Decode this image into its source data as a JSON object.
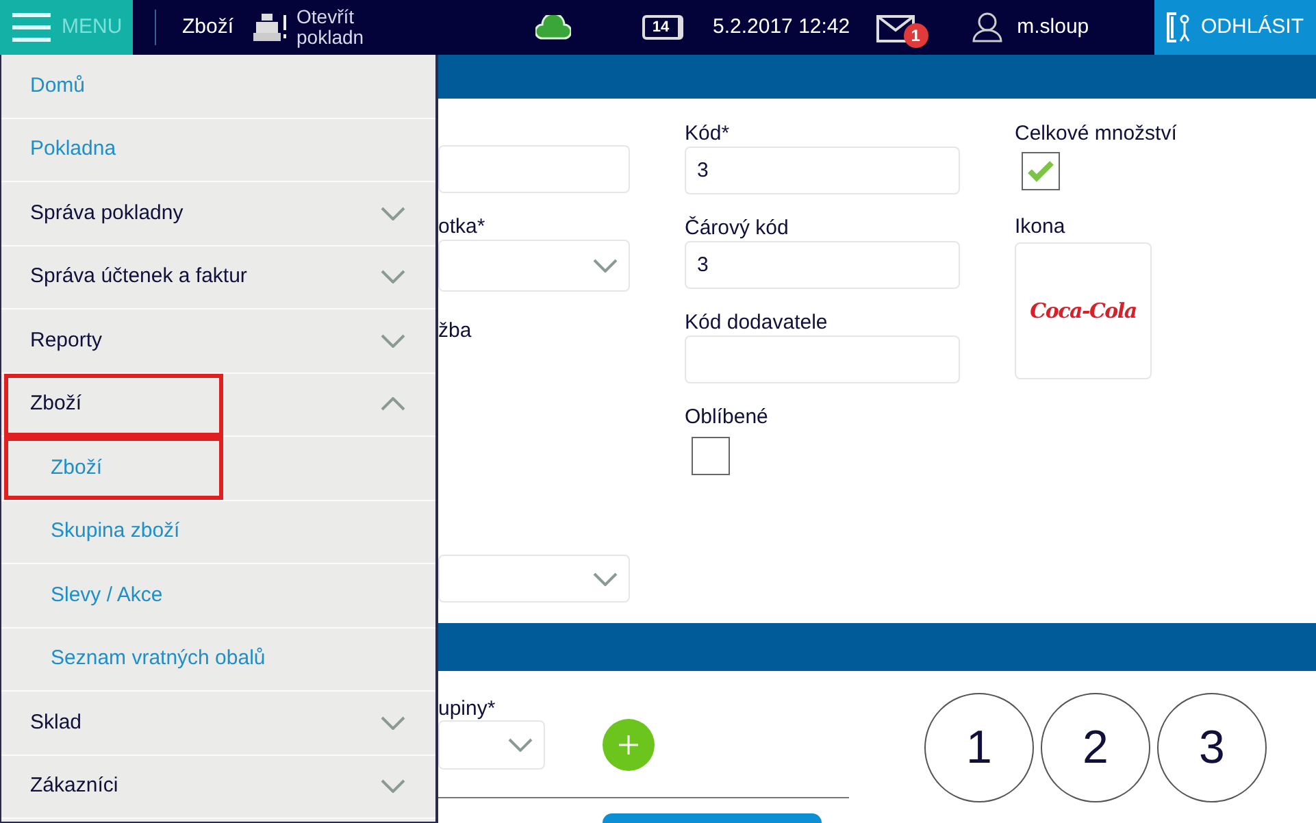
{
  "top_bar": {
    "menu_label": "MENU",
    "page_title": "Zboží",
    "register_label": "Otevřít pokladn",
    "battery_text": "14",
    "datetime": "5.2.2017 12:42",
    "mail_badge": "1",
    "user": "m.sloup",
    "logout_label": "ODHLÁSIT"
  },
  "menu": [
    {
      "label": "Domů",
      "kind": "link",
      "highlighted": false
    },
    {
      "label": "Pokladna",
      "kind": "link",
      "highlighted": false
    },
    {
      "label": "Správa pokladny",
      "kind": "group",
      "expanded": false,
      "highlighted": false
    },
    {
      "label": "Správa účtenek a faktur",
      "kind": "group",
      "expanded": false,
      "highlighted": false
    },
    {
      "label": "Reporty",
      "kind": "group",
      "expanded": false,
      "highlighted": false
    },
    {
      "label": "Zboží",
      "kind": "group",
      "expanded": true,
      "highlighted": true,
      "children": [
        {
          "label": "Zboží",
          "highlighted": true
        },
        {
          "label": "Skupina zboží",
          "highlighted": false
        },
        {
          "label": "Slevy / Akce",
          "highlighted": false
        },
        {
          "label": "Seznam vratných obalů",
          "highlighted": false
        }
      ]
    },
    {
      "label": "Sklad",
      "kind": "group",
      "expanded": false,
      "highlighted": false
    },
    {
      "label": "Zákazníci",
      "kind": "group",
      "expanded": false,
      "highlighted": false
    }
  ],
  "form": {
    "unit_label": "otka*",
    "service_label": "žba",
    "code_label": "Kód*",
    "code_value": "3",
    "barcode_label": "Čárový kód",
    "barcode_value": "3",
    "supplier_code_label": "Kód dodavatele",
    "favorite_label": "Oblíbené",
    "favorite_checked": false,
    "total_quantity_label": "Celkové množství",
    "total_quantity_checked": true,
    "icon_label": "Ikona",
    "icon_logo": "Coca-Cola"
  },
  "groups_section": {
    "group_label": "upiny*"
  },
  "keypad": [
    "1",
    "2",
    "3"
  ]
}
